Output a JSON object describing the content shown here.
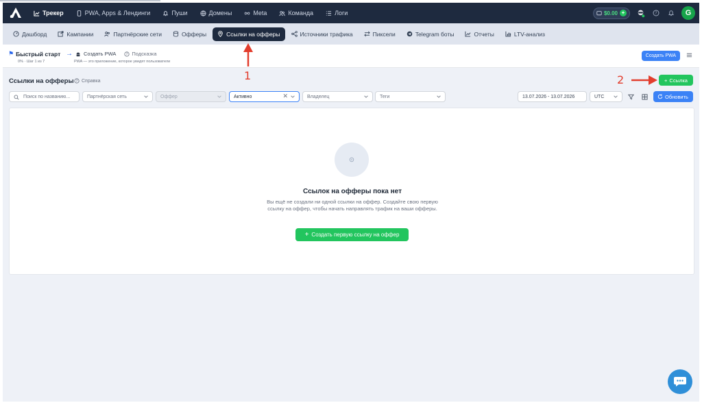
{
  "topnav": {
    "items": [
      {
        "label": "Трекер",
        "icon": "chart-line-icon",
        "active": true
      },
      {
        "label": "PWA, Apps & Лендинги",
        "icon": "phone-icon"
      },
      {
        "label": "Пуши",
        "icon": "bell-icon"
      },
      {
        "label": "Домены",
        "icon": "globe-icon"
      },
      {
        "label": "Meta",
        "icon": "infinity-icon"
      },
      {
        "label": "Команда",
        "icon": "users-icon"
      },
      {
        "label": "Логи",
        "icon": "list-icon"
      }
    ],
    "balance": "$0.00",
    "avatar_letter": "G"
  },
  "subnav": {
    "items": [
      {
        "label": "Дашборд",
        "icon": "gauge-icon"
      },
      {
        "label": "Кампании",
        "icon": "external-icon"
      },
      {
        "label": "Партнёрские сети",
        "icon": "users-icon"
      },
      {
        "label": "Офферы",
        "icon": "database-icon"
      },
      {
        "label": "Ссылки на офферы",
        "icon": "pin-icon",
        "active": true
      },
      {
        "label": "Источники трафика",
        "icon": "share-icon"
      },
      {
        "label": "Пиксели",
        "icon": "arrows-icon"
      },
      {
        "label": "Telegram боты",
        "icon": "telegram-icon"
      },
      {
        "label": "Отчеты",
        "icon": "report-icon"
      },
      {
        "label": "LTV-анализ",
        "icon": "bars-icon"
      }
    ]
  },
  "quickstart": {
    "title": "Быстрый старт",
    "progress": "0% · Шаг 1 из 7",
    "step_label": "Создать PWA",
    "hint_label": "Подсказка",
    "description": "PWA — это приложение, которое увидят пользователи",
    "create_pwa_button": "Создать PWA"
  },
  "page": {
    "title": "Ссылки на офферы",
    "help_label": "Справка",
    "add_link_button": "Ссылка"
  },
  "filters": {
    "search_placeholder": "Поиск по названию...",
    "partner_network": "Партнёрская сеть",
    "offer": "Оффер",
    "status": "Активно",
    "owner": "Владелец",
    "tags": "Теги",
    "date_range": "13.07.2026 - 13.07.2026",
    "timezone": "UTC",
    "refresh_button": "Обновить"
  },
  "empty_state": {
    "title": "Ссылок на офферы пока нет",
    "description": "Вы ещё не создали ни одной ссылки на оффер. Создайте свою первую ссылку на оффер, чтобы начать направлять трафик на ваши офферы.",
    "create_button": "Создать первую ссылку на оффер"
  },
  "annotations": {
    "marker_1": "1",
    "marker_2": "2",
    "color": "#e23d2d"
  },
  "colors": {
    "topbar": "#1e2a3f",
    "primary": "#3b82f6",
    "success": "#22c55e"
  }
}
